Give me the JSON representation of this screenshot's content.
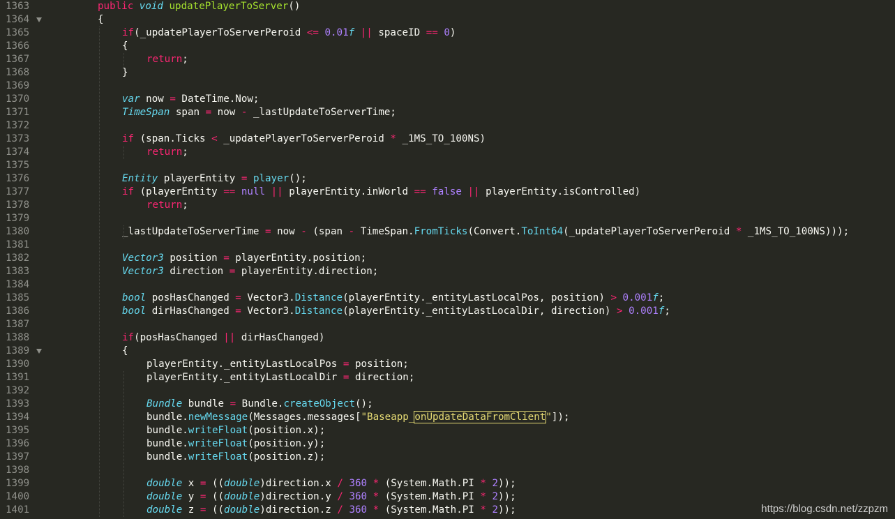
{
  "editor": {
    "theme_colors": {
      "background": "#272822",
      "keyword": "#f92672",
      "type": "#66d9ef",
      "number": "#ae81ff",
      "function": "#a6e22e",
      "string": "#e6db74",
      "plain": "#f8f8f2",
      "line_number": "#8f908a"
    },
    "lines": [
      {
        "n": "1363",
        "fold": false,
        "tokens": [
          [
            "kw",
            "public"
          ],
          [
            "p",
            " "
          ],
          [
            "type",
            "void"
          ],
          [
            "p",
            " "
          ],
          [
            "fn",
            "updatePlayerToServer"
          ],
          [
            "p",
            "()"
          ]
        ]
      },
      {
        "n": "1364",
        "fold": true,
        "tokens": [
          [
            "p",
            "{"
          ]
        ]
      },
      {
        "n": "1365",
        "fold": false,
        "tokens": [
          [
            "kw",
            "if"
          ],
          [
            "p",
            "(_updatePlayerToServerPeroid "
          ],
          [
            "op",
            "<="
          ],
          [
            "p",
            " "
          ],
          [
            "num",
            "0.01"
          ],
          [
            "numsuf",
            "f"
          ],
          [
            "p",
            " "
          ],
          [
            "op",
            "||"
          ],
          [
            "p",
            " spaceID "
          ],
          [
            "op",
            "=="
          ],
          [
            "p",
            " "
          ],
          [
            "num",
            "0"
          ],
          [
            "p",
            ")"
          ]
        ]
      },
      {
        "n": "1366",
        "fold": false,
        "tokens": [
          [
            "p",
            "{"
          ]
        ]
      },
      {
        "n": "1367",
        "fold": false,
        "tokens": [
          [
            "kw",
            "return"
          ],
          [
            "p",
            ";"
          ]
        ]
      },
      {
        "n": "1368",
        "fold": false,
        "tokens": [
          [
            "p",
            "}"
          ]
        ]
      },
      {
        "n": "1369",
        "fold": false,
        "tokens": []
      },
      {
        "n": "1370",
        "fold": false,
        "tokens": [
          [
            "type",
            "var"
          ],
          [
            "p",
            " now "
          ],
          [
            "op",
            "="
          ],
          [
            "p",
            " DateTime.Now;"
          ]
        ]
      },
      {
        "n": "1371",
        "fold": false,
        "tokens": [
          [
            "type",
            "TimeSpan"
          ],
          [
            "p",
            " span "
          ],
          [
            "op",
            "="
          ],
          [
            "p",
            " now "
          ],
          [
            "op",
            "-"
          ],
          [
            "p",
            " _lastUpdateToServerTime;"
          ]
        ]
      },
      {
        "n": "1372",
        "fold": false,
        "tokens": []
      },
      {
        "n": "1373",
        "fold": false,
        "tokens": [
          [
            "kw",
            "if"
          ],
          [
            "p",
            " (span.Ticks "
          ],
          [
            "op",
            "<"
          ],
          [
            "p",
            " _updatePlayerToServerPeroid "
          ],
          [
            "op",
            "*"
          ],
          [
            "p",
            " _1MS_TO_100NS)"
          ]
        ]
      },
      {
        "n": "1374",
        "fold": false,
        "tokens": [
          [
            "kw",
            "return"
          ],
          [
            "p",
            ";"
          ]
        ]
      },
      {
        "n": "1375",
        "fold": false,
        "tokens": []
      },
      {
        "n": "1376",
        "fold": false,
        "tokens": [
          [
            "type",
            "Entity"
          ],
          [
            "p",
            " playerEntity "
          ],
          [
            "op",
            "="
          ],
          [
            "p",
            " "
          ],
          [
            "call",
            "player"
          ],
          [
            "p",
            "();"
          ]
        ]
      },
      {
        "n": "1377",
        "fold": false,
        "tokens": [
          [
            "kw",
            "if"
          ],
          [
            "p",
            " (playerEntity "
          ],
          [
            "op",
            "=="
          ],
          [
            "p",
            " "
          ],
          [
            "bool",
            "null"
          ],
          [
            "p",
            " "
          ],
          [
            "op",
            "||"
          ],
          [
            "p",
            " playerEntity.inWorld "
          ],
          [
            "op",
            "=="
          ],
          [
            "p",
            " "
          ],
          [
            "bool",
            "false"
          ],
          [
            "p",
            " "
          ],
          [
            "op",
            "||"
          ],
          [
            "p",
            " playerEntity.isControlled)"
          ]
        ]
      },
      {
        "n": "1378",
        "fold": false,
        "tokens": [
          [
            "kw",
            "return"
          ],
          [
            "p",
            ";"
          ]
        ]
      },
      {
        "n": "1379",
        "fold": false,
        "tokens": []
      },
      {
        "n": "1380",
        "fold": false,
        "tokens": [
          [
            "p",
            "_lastUpdateToServerTime "
          ],
          [
            "op",
            "="
          ],
          [
            "p",
            " now "
          ],
          [
            "op",
            "-"
          ],
          [
            "p",
            " (span "
          ],
          [
            "op",
            "-"
          ],
          [
            "p",
            " TimeSpan."
          ],
          [
            "call",
            "FromTicks"
          ],
          [
            "p",
            "(Convert."
          ],
          [
            "call",
            "ToInt64"
          ],
          [
            "p",
            "(_updatePlayerToServerPeroid "
          ],
          [
            "op",
            "*"
          ],
          [
            "p",
            " _1MS_TO_100NS)));"
          ]
        ]
      },
      {
        "n": "1381",
        "fold": false,
        "tokens": []
      },
      {
        "n": "1382",
        "fold": false,
        "tokens": [
          [
            "type",
            "Vector3"
          ],
          [
            "p",
            " position "
          ],
          [
            "op",
            "="
          ],
          [
            "p",
            " playerEntity.position;"
          ]
        ]
      },
      {
        "n": "1383",
        "fold": false,
        "tokens": [
          [
            "type",
            "Vector3"
          ],
          [
            "p",
            " direction "
          ],
          [
            "op",
            "="
          ],
          [
            "p",
            " playerEntity.direction;"
          ]
        ]
      },
      {
        "n": "1384",
        "fold": false,
        "tokens": []
      },
      {
        "n": "1385",
        "fold": false,
        "tokens": [
          [
            "type",
            "bool"
          ],
          [
            "p",
            " posHasChanged "
          ],
          [
            "op",
            "="
          ],
          [
            "p",
            " Vector3."
          ],
          [
            "call",
            "Distance"
          ],
          [
            "p",
            "(playerEntity._entityLastLocalPos, position) "
          ],
          [
            "op",
            ">"
          ],
          [
            "p",
            " "
          ],
          [
            "num",
            "0.001"
          ],
          [
            "numsuf",
            "f"
          ],
          [
            "p",
            ";"
          ]
        ]
      },
      {
        "n": "1386",
        "fold": false,
        "tokens": [
          [
            "type",
            "bool"
          ],
          [
            "p",
            " dirHasChanged "
          ],
          [
            "op",
            "="
          ],
          [
            "p",
            " Vector3."
          ],
          [
            "call",
            "Distance"
          ],
          [
            "p",
            "(playerEntity._entityLastLocalDir, direction) "
          ],
          [
            "op",
            ">"
          ],
          [
            "p",
            " "
          ],
          [
            "num",
            "0.001"
          ],
          [
            "numsuf",
            "f"
          ],
          [
            "p",
            ";"
          ]
        ]
      },
      {
        "n": "1387",
        "fold": false,
        "tokens": []
      },
      {
        "n": "1388",
        "fold": false,
        "tokens": [
          [
            "kw",
            "if"
          ],
          [
            "p",
            "(posHasChanged "
          ],
          [
            "op",
            "||"
          ],
          [
            "p",
            " dirHasChanged)"
          ]
        ]
      },
      {
        "n": "1389",
        "fold": true,
        "tokens": [
          [
            "p",
            "{"
          ]
        ]
      },
      {
        "n": "1390",
        "fold": false,
        "tokens": [
          [
            "p",
            "playerEntity._entityLastLocalPos "
          ],
          [
            "op",
            "="
          ],
          [
            "p",
            " position;"
          ]
        ]
      },
      {
        "n": "1391",
        "fold": false,
        "tokens": [
          [
            "p",
            "playerEntity._entityLastLocalDir "
          ],
          [
            "op",
            "="
          ],
          [
            "p",
            " direction;"
          ]
        ]
      },
      {
        "n": "1392",
        "fold": false,
        "tokens": []
      },
      {
        "n": "1393",
        "fold": false,
        "tokens": [
          [
            "type",
            "Bundle"
          ],
          [
            "p",
            " bundle "
          ],
          [
            "op",
            "="
          ],
          [
            "p",
            " Bundle."
          ],
          [
            "call",
            "createObject"
          ],
          [
            "p",
            "();"
          ]
        ]
      },
      {
        "n": "1394",
        "fold": false,
        "tokens": [
          [
            "p",
            "bundle."
          ],
          [
            "call",
            "newMessage"
          ],
          [
            "p",
            "(Messages.messages["
          ],
          [
            "str",
            "\"Baseapp_"
          ],
          [
            "strbox",
            "onUpdateDataFromClient"
          ],
          [
            "str",
            "\""
          ],
          [
            "p",
            "]);"
          ]
        ]
      },
      {
        "n": "1395",
        "fold": false,
        "tokens": [
          [
            "p",
            "bundle."
          ],
          [
            "call",
            "writeFloat"
          ],
          [
            "p",
            "(position.x);"
          ]
        ]
      },
      {
        "n": "1396",
        "fold": false,
        "tokens": [
          [
            "p",
            "bundle."
          ],
          [
            "call",
            "writeFloat"
          ],
          [
            "p",
            "(position.y);"
          ]
        ]
      },
      {
        "n": "1397",
        "fold": false,
        "tokens": [
          [
            "p",
            "bundle."
          ],
          [
            "call",
            "writeFloat"
          ],
          [
            "p",
            "(position.z);"
          ]
        ]
      },
      {
        "n": "1398",
        "fold": false,
        "tokens": []
      },
      {
        "n": "1399",
        "fold": false,
        "tokens": [
          [
            "type",
            "double"
          ],
          [
            "p",
            " x "
          ],
          [
            "op",
            "="
          ],
          [
            "p",
            " (("
          ],
          [
            "type",
            "double"
          ],
          [
            "p",
            ")direction.x "
          ],
          [
            "op",
            "/"
          ],
          [
            "p",
            " "
          ],
          [
            "num",
            "360"
          ],
          [
            "p",
            " "
          ],
          [
            "op",
            "*"
          ],
          [
            "p",
            " (System.Math.PI "
          ],
          [
            "op",
            "*"
          ],
          [
            "p",
            " "
          ],
          [
            "num",
            "2"
          ],
          [
            "p",
            "));"
          ]
        ]
      },
      {
        "n": "1400",
        "fold": false,
        "tokens": [
          [
            "type",
            "double"
          ],
          [
            "p",
            " y "
          ],
          [
            "op",
            "="
          ],
          [
            "p",
            " (("
          ],
          [
            "type",
            "double"
          ],
          [
            "p",
            ")direction.y "
          ],
          [
            "op",
            "/"
          ],
          [
            "p",
            " "
          ],
          [
            "num",
            "360"
          ],
          [
            "p",
            " "
          ],
          [
            "op",
            "*"
          ],
          [
            "p",
            " (System.Math.PI "
          ],
          [
            "op",
            "*"
          ],
          [
            "p",
            " "
          ],
          [
            "num",
            "2"
          ],
          [
            "p",
            "));"
          ]
        ]
      },
      {
        "n": "1401",
        "fold": false,
        "tokens": [
          [
            "type",
            "double"
          ],
          [
            "p",
            " z "
          ],
          [
            "op",
            "="
          ],
          [
            "p",
            " (("
          ],
          [
            "type",
            "double"
          ],
          [
            "p",
            ")direction.z "
          ],
          [
            "op",
            "/"
          ],
          [
            "p",
            " "
          ],
          [
            "num",
            "360"
          ],
          [
            "p",
            " "
          ],
          [
            "op",
            "*"
          ],
          [
            "p",
            " (System.Math.PI "
          ],
          [
            "op",
            "*"
          ],
          [
            "p",
            " "
          ],
          [
            "num",
            "2"
          ],
          [
            "p",
            "));"
          ]
        ]
      }
    ]
  },
  "watermark": "https://blog.csdn.net/zzpzm"
}
